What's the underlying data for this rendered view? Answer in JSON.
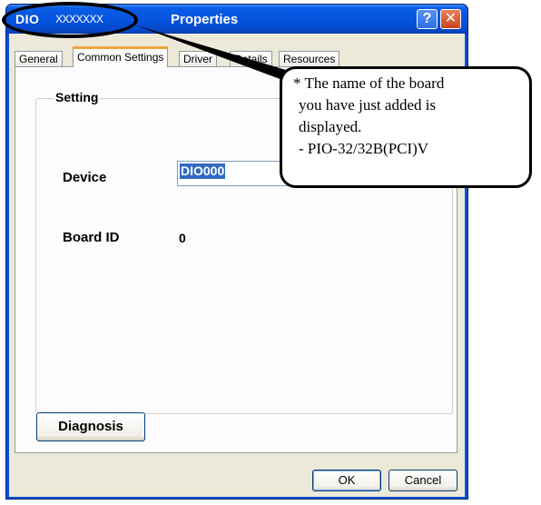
{
  "window": {
    "title_app": "DIO",
    "title_sub": "XXXXXXX",
    "title_main": "Properties",
    "help_label": "?",
    "close_label": "✕"
  },
  "tabs": [
    {
      "label": "General"
    },
    {
      "label": "Common Settings",
      "active": true
    },
    {
      "label": "Driver"
    },
    {
      "label": "Details"
    },
    {
      "label": "Resources"
    }
  ],
  "group": {
    "title": "Setting",
    "device_label": "Device",
    "device_value": "DIO000",
    "board_id_label": "Board ID",
    "board_id_value": "0"
  },
  "buttons": {
    "diagnosis": "Diagnosis",
    "ok": "OK",
    "cancel": "Cancel"
  },
  "callout": {
    "lines": [
      "* The name of the board",
      "you have just added is",
      "displayed.",
      "- PIO-32/32B(PCI)V"
    ]
  }
}
